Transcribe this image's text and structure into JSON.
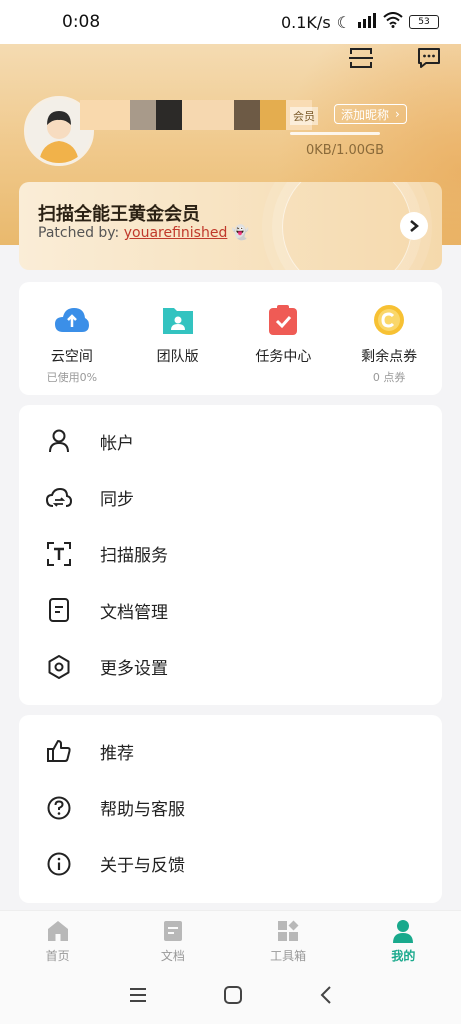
{
  "status": {
    "time": "0:08",
    "speed": "0.1K/s",
    "battery": "53"
  },
  "profile": {
    "member_tag": "会员",
    "add_nickname": "添加昵称",
    "storage": "0KB/1.00GB"
  },
  "gold_card": {
    "title": "扫描全能王黄金会员",
    "sub_prefix": "Patched by: ",
    "sub_link": "youarefinished"
  },
  "grid": [
    {
      "label": "云空间",
      "sub": "已使用0%",
      "icon": "cloud-upload-icon"
    },
    {
      "label": "团队版",
      "sub": "",
      "icon": "team-folder-icon"
    },
    {
      "label": "任务中心",
      "sub": "",
      "icon": "task-clipboard-icon"
    },
    {
      "label": "剩余点券",
      "sub": "0 点券",
      "icon": "coin-icon"
    }
  ],
  "menu1": [
    {
      "label": "帐户",
      "icon": "user-icon"
    },
    {
      "label": "同步",
      "icon": "cloud-sync-icon"
    },
    {
      "label": "扫描服务",
      "icon": "scan-text-icon"
    },
    {
      "label": "文档管理",
      "icon": "document-icon"
    },
    {
      "label": "更多设置",
      "icon": "gear-icon"
    }
  ],
  "menu2": [
    {
      "label": "推荐",
      "icon": "thumbs-up-icon"
    },
    {
      "label": "帮助与客服",
      "icon": "help-icon"
    },
    {
      "label": "关于与反馈",
      "icon": "info-icon"
    }
  ],
  "tabs": [
    {
      "label": "首页",
      "icon": "home-icon"
    },
    {
      "label": "文档",
      "icon": "docs-icon"
    },
    {
      "label": "工具箱",
      "icon": "toolbox-icon"
    },
    {
      "label": "我的",
      "icon": "profile-icon",
      "active": true
    }
  ],
  "colors": {
    "accent": "#19a98c",
    "gold_start": "#f6e3c2",
    "gold_end": "#e9b96d"
  }
}
